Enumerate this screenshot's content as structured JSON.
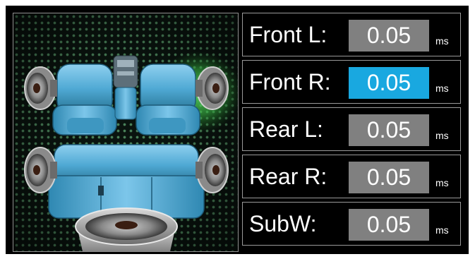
{
  "channels": [
    {
      "id": "front-l",
      "label": "Front L:",
      "value": "0.05",
      "unit": "ms",
      "selected": false
    },
    {
      "id": "front-r",
      "label": "Front R:",
      "value": "0.05",
      "unit": "ms",
      "selected": true
    },
    {
      "id": "rear-l",
      "label": "Rear L:",
      "value": "0.05",
      "unit": "ms",
      "selected": false
    },
    {
      "id": "rear-r",
      "label": "Rear R:",
      "value": "0.05",
      "unit": "ms",
      "selected": false
    },
    {
      "id": "subw",
      "label": "SubW:",
      "value": "0.05",
      "unit": "ms",
      "selected": false
    }
  ],
  "colors": {
    "selected": "#19a8e0",
    "value_box": "#808080",
    "seat": "#4fa9d4",
    "speaker_glow": "#59d65f",
    "dot_pattern": "#7ddc96"
  },
  "icons": {
    "front_left_speaker": "speaker-icon",
    "front_right_speaker": "speaker-icon",
    "rear_left_speaker": "speaker-icon",
    "rear_right_speaker": "speaker-icon",
    "subwoofer": "subwoofer-icon",
    "seats": "car-seats-icon"
  }
}
